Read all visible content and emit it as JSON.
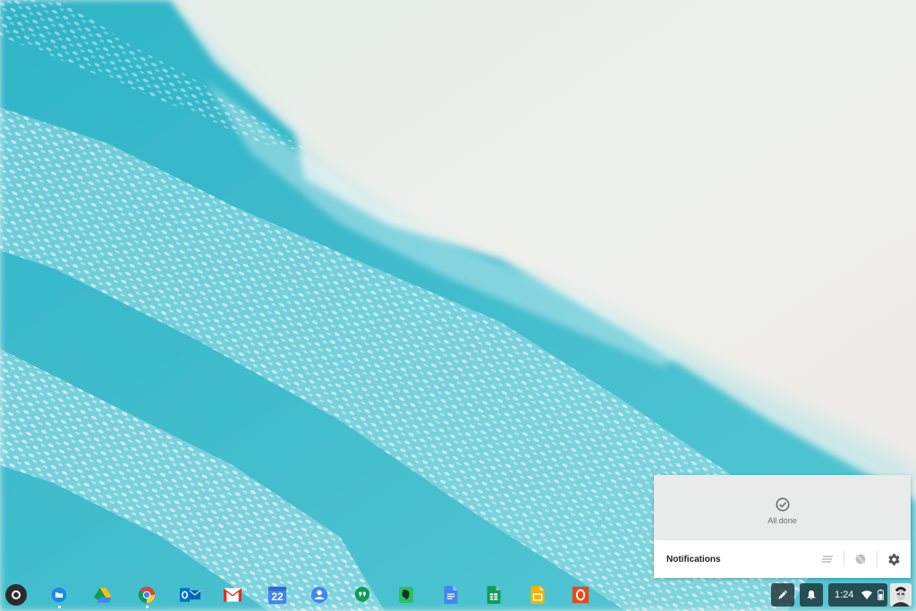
{
  "notification_center": {
    "empty_message": "All done",
    "title": "Notifications"
  },
  "shelf": {
    "apps": [
      {
        "name": "Files",
        "icon": "files-icon",
        "color": "#1e88e5",
        "running": true
      },
      {
        "name": "Google Drive",
        "icon": "drive-icon",
        "running": false
      },
      {
        "name": "Chrome",
        "icon": "chrome-icon",
        "running": true
      },
      {
        "name": "Outlook",
        "icon": "outlook-icon",
        "color": "#0a64ad",
        "running": false
      },
      {
        "name": "Gmail",
        "icon": "gmail-icon",
        "color": "#d93025",
        "running": false
      },
      {
        "name": "Calendar",
        "icon": "calendar-icon",
        "color": "#4285f4",
        "running": false
      },
      {
        "name": "Contacts",
        "icon": "contacts-icon",
        "color": "#4285f4",
        "running": false
      },
      {
        "name": "Hangouts",
        "icon": "hangouts-icon",
        "color": "#0f9d58",
        "running": false
      },
      {
        "name": "Evernote",
        "icon": "evernote-icon",
        "color": "#2dbe60",
        "running": false
      },
      {
        "name": "Docs",
        "icon": "docs-icon",
        "color": "#4285f4",
        "running": false
      },
      {
        "name": "Sheets",
        "icon": "sheets-icon",
        "color": "#0f9d58",
        "running": false
      },
      {
        "name": "Slides",
        "icon": "slides-icon",
        "color": "#f4b400",
        "running": false
      },
      {
        "name": "Office",
        "icon": "office-icon",
        "color": "#e64a19",
        "running": false
      }
    ],
    "calendar_day": "22",
    "status": {
      "time": "1:24",
      "wifi": "wifi-icon",
      "battery": "battery-icon"
    }
  }
}
